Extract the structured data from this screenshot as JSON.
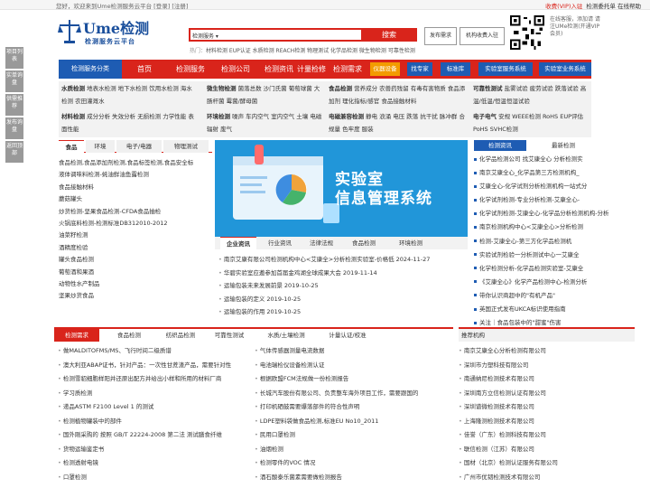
{
  "topbar": {
    "welcome": "您好，欢迎来到Ume检测服务云平台",
    "login": "[登录]",
    "register": "[注册]",
    "vip": "收费(VIP)入驻",
    "links": "检测委托单 在线帮助"
  },
  "logo": {
    "name": "Ume检测",
    "tagline": "检测服务云平台"
  },
  "search": {
    "select": "检测服务",
    "button": "搜索",
    "hot_label": "热门：",
    "hot": "材料检测 EUP认证 水质检测 REACH检测 物理测试 化学品检测 微生物检测 可靠性检测"
  },
  "buttons": {
    "publish": "发布需求",
    "join": "机构收费入驻"
  },
  "qr_text": "在线客服，添加请 请注UMe检测(开通VIP会员)",
  "side": [
    "项目列表",
    "实单询盘",
    "供需推荐",
    "发布询盘",
    "返回顶部"
  ],
  "nav": {
    "category": "检测服务分类",
    "items": [
      "首页",
      "检测服务",
      "检测公司",
      "检测资讯",
      "计量检修",
      "检测需求"
    ],
    "boxes": [
      "仪器设备",
      "找专家",
      "标准库",
      "实验室服务系统",
      "实验室业务系统"
    ]
  },
  "grid": [
    {
      "head": "水质检测",
      "text": "地表水检测 地下水检测 饮用水检测 海水检测 农田灌溉水"
    },
    {
      "head": "微生物检测",
      "text": "菌落总数 沙门氏菌 葡萄球菌 大肠杆菌 霉菌/酵母菌"
    },
    {
      "head": "食品检测",
      "text": "营养成分 农兽药残留 有毒有害物质 食品添加剂 理化指标/感官 食品接触材料"
    },
    {
      "head": "可靠性测试",
      "text": "盐雾试验 疲劳试验 跌落试验 高温/低温/恒温恒湿试验"
    },
    {
      "head": "材料检测",
      "text": "成分分析 失效分析 无损检测 力学性能 表面性能"
    },
    {
      "head": "环境检测",
      "text": "噪声 车内空气 室内空气 土壤 电磁辐射 废气"
    },
    {
      "head": "电磁兼容检测",
      "text": "静电 浪涌 电压 跌落 抗干扰 脉冲群 合规量 色牢度 服装"
    },
    {
      "head": "电子电气",
      "text": "安规 WEEE检测 RoHS EUP评估 PoHS SVHC检测"
    }
  ],
  "left": {
    "tabs": [
      "食品",
      "环境",
      "电子/电器",
      "物理测试"
    ],
    "items": [
      "食品检测,食品添加剂检测,食品标签检测,食品安全标",
      "液体调味料检测-蚝油鲜油鱼露检测",
      "食品接触材料",
      "蘑菇罐头",
      "炒货检测-坚果食品检测-CFDA食品抽检",
      "火锅底料检测-检测标准DB312010-2012",
      "油菜籽检测",
      "酒精度检验",
      "罐头食品检测",
      "葡萄酒和果酒",
      "动物性水产制品",
      "坚果炒货食品"
    ]
  },
  "banner": {
    "line1": "实验室",
    "line2": "信息管理系统"
  },
  "news": {
    "tabs": [
      "企业资讯",
      "行业资讯",
      "法律法规",
      "食品检测",
      "环境检测"
    ],
    "items": [
      "南京艾康有限公司检测机构中心<艾康全>分析检测实验室-价格低 2024-11-27",
      "华碧实验室应邀参加首届金鸡湖全球成果大会 2019-11-14",
      "运输包装未来发展前景 2019-10-25",
      "运输包装的定义 2019-10-25",
      "运输包装的作用 2019-10-25"
    ]
  },
  "right": {
    "tabs": [
      "检测资讯",
      "最新检测"
    ],
    "items": [
      "化学品检测公司 找艾康全心 分析检测实",
      "南京艾康全心_化学品第三方检测机构_",
      "艾康全心-化学试剂分析检测机构一站式分",
      "化学试剂检测-专业分析检测-艾康全心-",
      "化学试剂检测-艾康全心-化学品分析检测机构-分析",
      "南京检测机构中心<艾康全心>分析检测",
      "检测-艾康全心-第三方化学品检测机",
      "实验试剂检验一分析测试中心一艾康全",
      "化学检测分析-化学品检测实验室-艾康全",
      "《艾康全心》化学产品检测中心-检测分析",
      "带你认识商超中的\"有机产品\"",
      "英国正式发布UKCA标识使用指南",
      "关注｜食品包装中的\"甜蜜\"伤害"
    ]
  },
  "bottom": {
    "tabs": [
      "检测需求",
      "食品检测",
      "纺织品检测",
      "可靠性测试",
      "水质/土壤检测",
      "计量认证/校准"
    ],
    "col1": [
      "做MALDITOFMS/MS、飞行时间二级质谱",
      "澳大利亚ABAP证书，针对产品：一次性甘蔗渣产品，需要针对性",
      "检测雪貂细胞样阳并还原出配方并给出小样和所用的材料厂商",
      "学习质检测",
      "递品ASTM F2100 Level 1 的测试",
      "检测植物罐装中的部件",
      "国外刚采购的 按照 GB/T 22224-2008 第二法 测试膳食纤维",
      "货物运输鉴定书",
      "检测透射电镜",
      "口罩检测"
    ],
    "col2": [
      "气体传感器测量电流数据",
      "电池瑞检仪设备检测认证",
      "根据欧盟FCM法规做一份检测报告",
      "长城汽车股份有限公司、负责整车海外项目工作，需要跟国的",
      "打印机硒鼓需要爆落部件的符合性声明",
      "LDPE塑料袋做食品检测,标准EU No10_2011",
      "民用口罩检测",
      "油烟检测",
      "检测零件的VOC 情况",
      "酒石酸泰乐菌素需要做检测报告"
    ]
  },
  "rec": {
    "title": "推荐机构",
    "items": [
      "南京艾康全心分析检测有限公司",
      "深圳市力塑科技有限公司",
      "南通纳尼检测技术有限公司",
      "深圳南方立信检测认证有限公司",
      "深圳谱微检测技术有限公司",
      "上海隆测检测技术有限公司",
      "佳誉（广东）检测科技有限公司",
      "联信检测（江苏）有限公司",
      "国材（北京）检测认证服务有限公司",
      "广州市优韧检测技术有限公司"
    ]
  }
}
